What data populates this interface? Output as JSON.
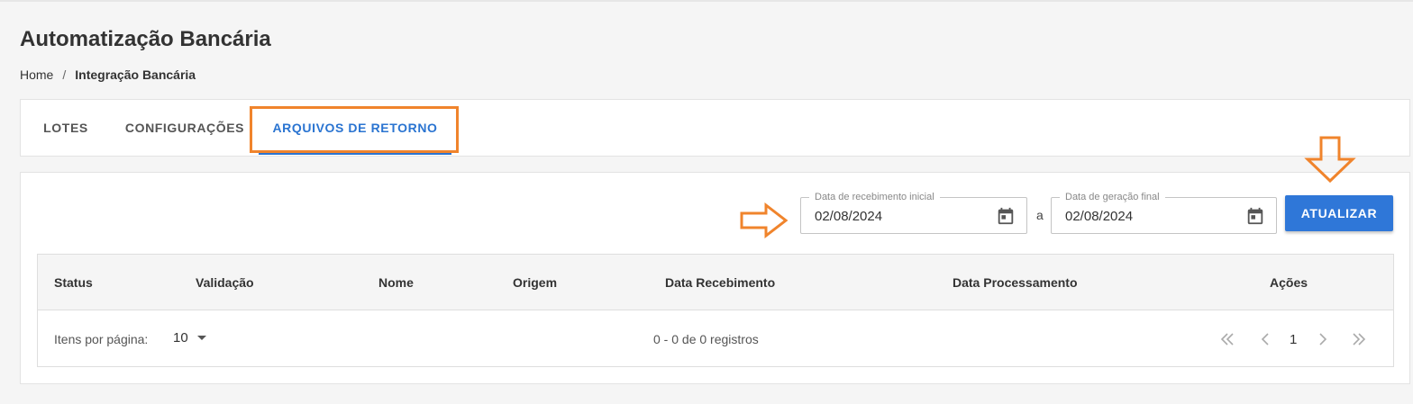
{
  "header": {
    "title": "Automatização Bancária",
    "breadcrumb": {
      "home": "Home",
      "separator": "/",
      "current": "Integração Bancária"
    }
  },
  "tabs": [
    {
      "label": "LOTES",
      "active": false
    },
    {
      "label": "CONFIGURAÇÕES",
      "active": false
    },
    {
      "label": "ARQUIVOS DE RETORNO",
      "active": true
    }
  ],
  "filters": {
    "start": {
      "label": "Data de recebimento inicial",
      "value": "02/08/2024",
      "icon": "calendar-icon"
    },
    "range_separator": "a",
    "end": {
      "label": "Data de geração final",
      "value": "02/08/2024",
      "icon": "calendar-icon"
    },
    "update_button": "ATUALIZAR"
  },
  "table": {
    "columns": [
      "Status",
      "Validação",
      "Nome",
      "Origem",
      "Data Recebimento",
      "Data Processamento",
      "Ações"
    ],
    "rows": []
  },
  "pagination": {
    "items_per_page_label": "Itens por página:",
    "items_per_page": "10",
    "range_text": "0 - 0 de 0 registros",
    "current_page": "1"
  },
  "colors": {
    "accent": "#2a74d1",
    "button": "#2f77d8",
    "annotation": "#f0842c"
  }
}
